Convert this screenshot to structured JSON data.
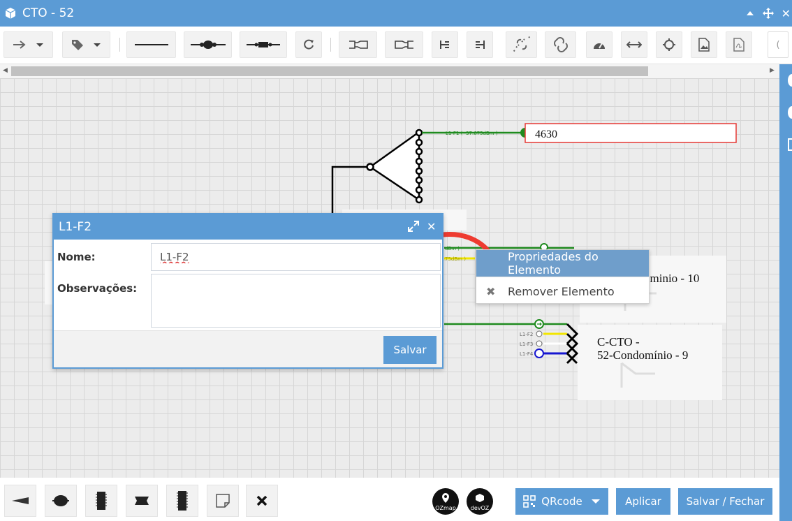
{
  "window": {
    "title": "CTO - 52"
  },
  "canvas": {
    "node_label": "4630",
    "box_labels": {
      "c10": "ominio - 10",
      "c9_line1": "C-CTO -",
      "c9_line2": "52-Condomínio - 9"
    },
    "fiber_labels": {
      "l1f1": "L1-F1 ( -37.675dBm )",
      "l1f2_partial": "dBm )",
      "l1f3_partial": "75dBm )",
      "port_f2": "L1-F2",
      "port_f3": "L1-F3",
      "port_f4": "L1-F4"
    }
  },
  "dialog": {
    "title": "L1-F2",
    "name_label": "Nome:",
    "name_value": "L1-F2",
    "obs_label": "Observações:",
    "obs_value": "",
    "save_label": "Salvar"
  },
  "context_menu": {
    "items": [
      {
        "label": "Propriedades do Elemento"
      },
      {
        "label": "Remover Elemento"
      }
    ]
  },
  "bottom": {
    "qrcode_label": "QRcode",
    "apply_label": "Aplicar",
    "save_close_label": "Salvar / Fechar",
    "logo1": "OZmap",
    "logo2": "devOZ"
  },
  "colors": {
    "accent": "#5b9bd5",
    "fiber_green": "#1f8b1f",
    "fiber_yellow": "#f2e600",
    "fiber_blue": "#1515d0",
    "highlight_red": "#e53935",
    "arrow_red": "#ee3b30"
  }
}
